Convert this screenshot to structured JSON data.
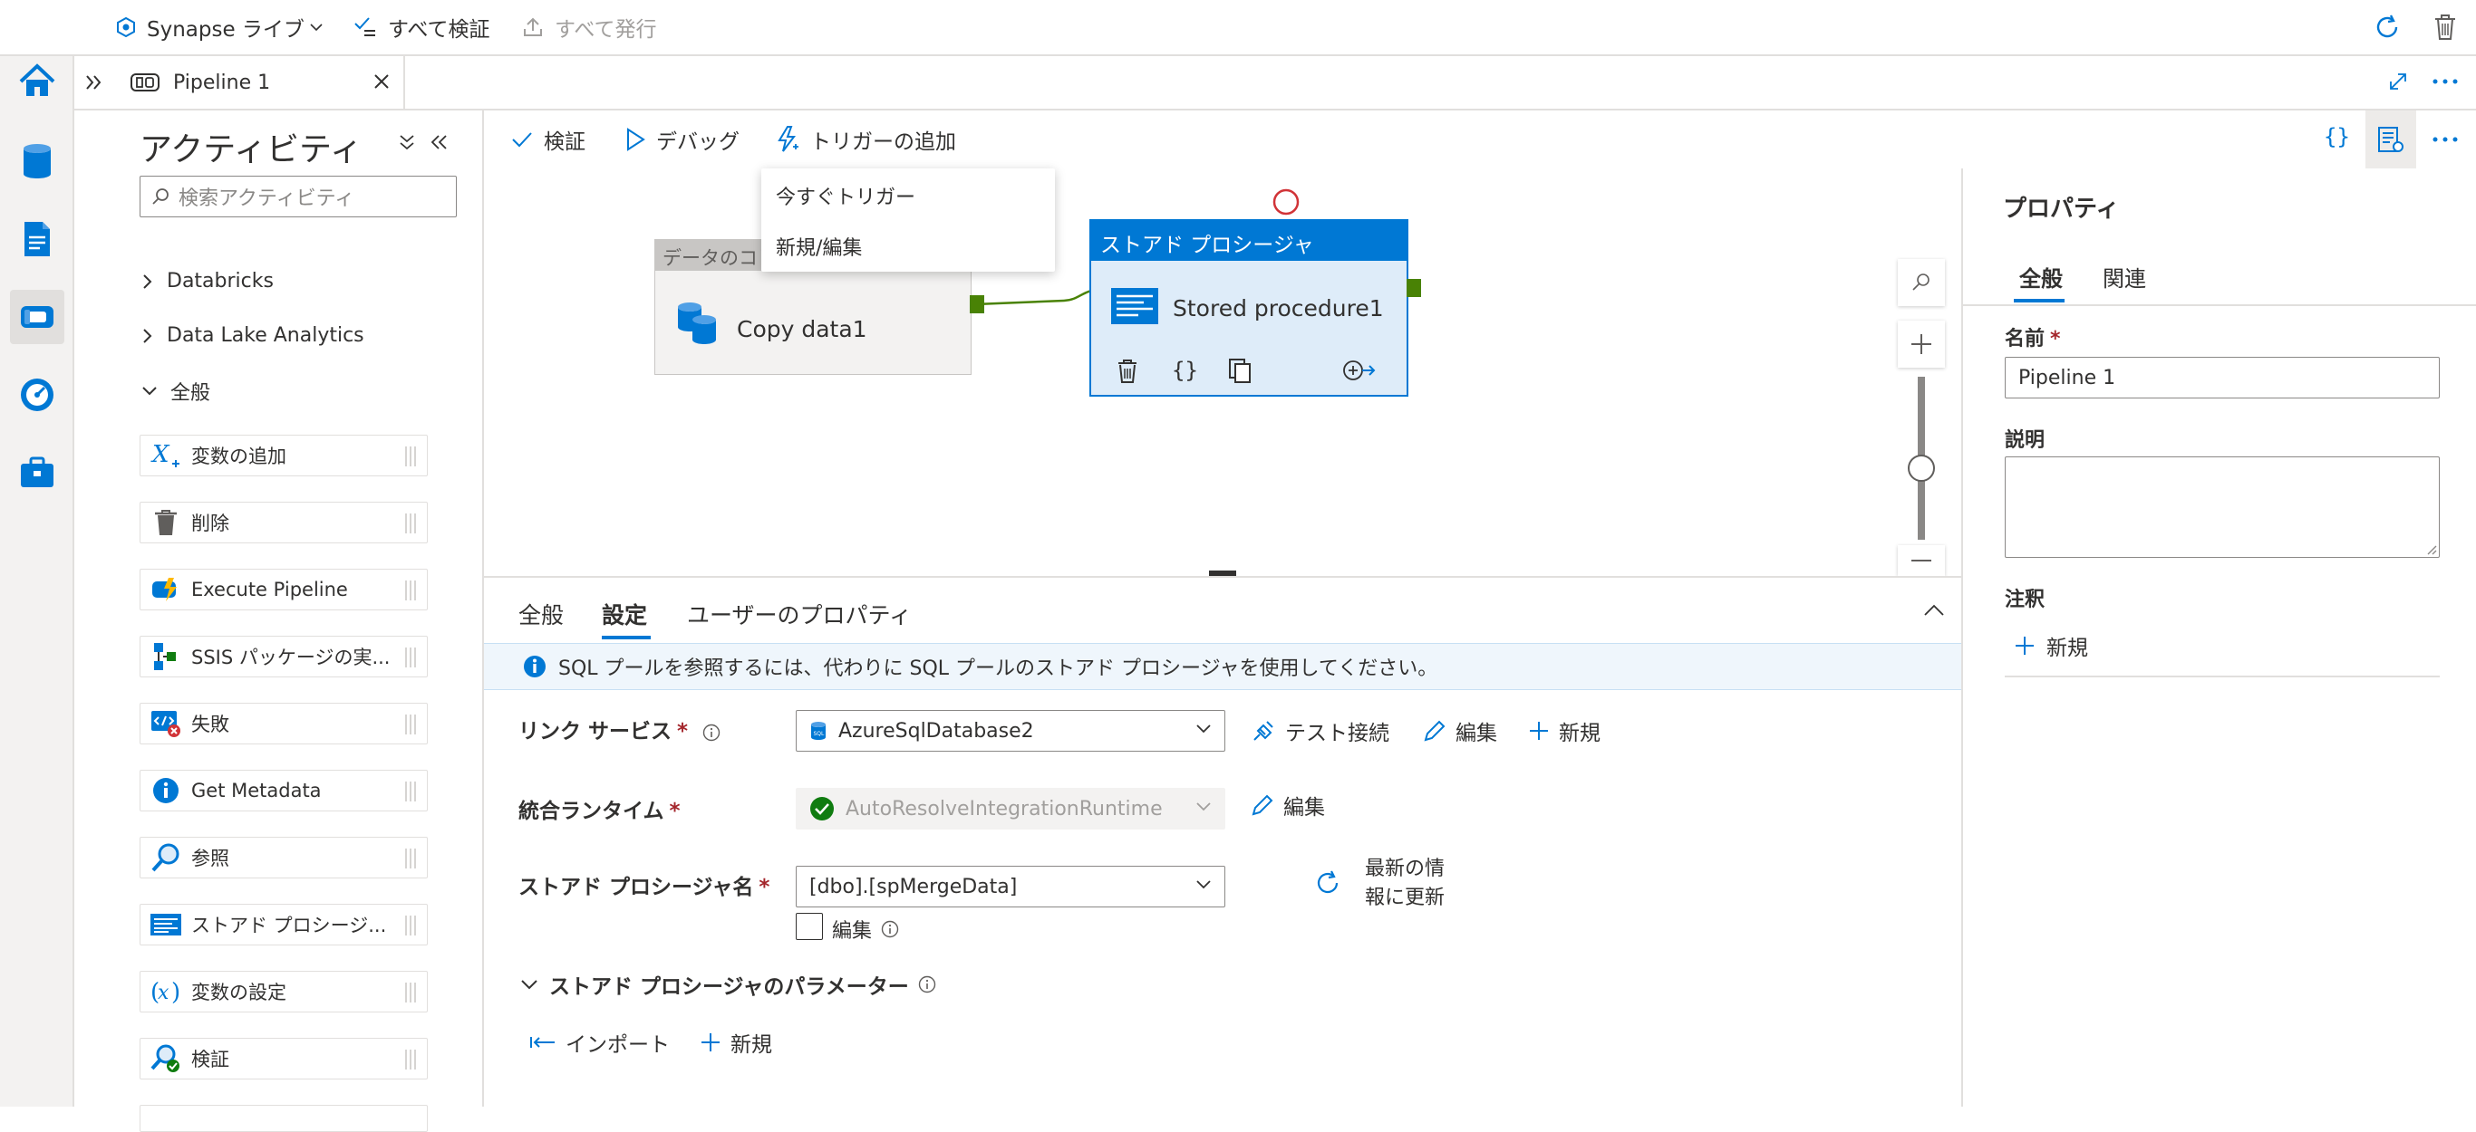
{
  "topbar": {
    "workspace_label": "Synapse ライブ",
    "validate_all": "すべて検証",
    "publish_all": "すべて発行"
  },
  "tab": {
    "title": "Pipeline 1"
  },
  "activities": {
    "title": "アクティビティ",
    "search_placeholder": "検索アクティビティ",
    "groups": [
      "Databricks",
      "Data Lake Analytics",
      "全般"
    ],
    "items": [
      "変数の追加",
      "削除",
      "Execute Pipeline",
      "SSIS パッケージの実...",
      "失敗",
      "Get Metadata",
      "参照",
      "ストアド プロシージ...",
      "変数の設定",
      "検証"
    ]
  },
  "canvas_toolbar": {
    "validate": "検証",
    "debug": "デバッグ",
    "add_trigger": "トリガーの追加"
  },
  "trigger_menu": {
    "trigger_now": "今すぐトリガー",
    "new_edit": "新規/編集"
  },
  "canvas": {
    "copy_header": "データのコピー",
    "copy_name": "Copy data1",
    "sp_header": "ストアド プロシージャ",
    "sp_name": "Stored procedure1"
  },
  "bottom": {
    "tabs": [
      "全般",
      "設定",
      "ユーザーのプロパティ"
    ],
    "active_tab": "設定",
    "info": "SQL プールを参照するには、代わりに SQL プールのストアド プロシージャを使用してください。",
    "linked_service_label": "リンク サービス",
    "linked_service_value": "AzureSqlDatabase2",
    "test_connection": "テスト接続",
    "edit": "編集",
    "new": "新規",
    "runtime_label": "統合ランタイム",
    "runtime_value": "AutoResolveIntegrationRuntime",
    "sp_name_label": "ストアド プロシージャ名",
    "sp_name_value": "[dbo].[spMergeData]",
    "refresh_line1": "最新の情",
    "refresh_line2": "報に更新",
    "edit_checkbox": "編集",
    "params_label": "ストアド プロシージャのパラメーター",
    "import": "インポート",
    "required_mark": "*"
  },
  "properties": {
    "title": "プロパティ",
    "tabs": [
      "全般",
      "関連"
    ],
    "name_label": "名前",
    "name_value": "Pipeline 1",
    "desc_label": "説明",
    "annotations_label": "注釈",
    "new_label": "新規"
  },
  "colors": {
    "accent": "#0078d4",
    "node_header": "#0078d4",
    "node_selected_bg": "#deecf9",
    "success_green": "#107c10",
    "connector_green": "#498205"
  }
}
